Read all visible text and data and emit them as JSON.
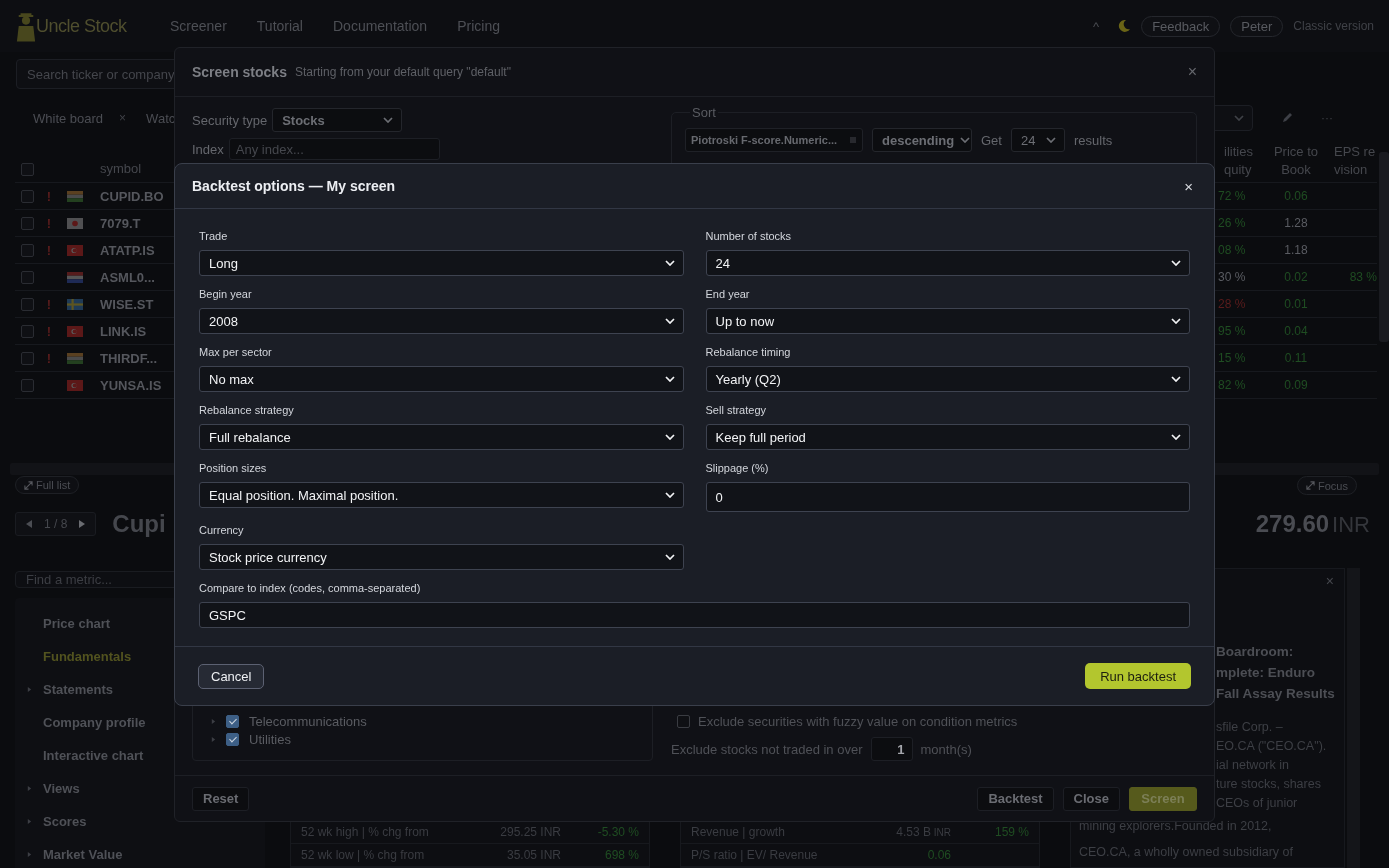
{
  "header": {
    "logo": "Uncle Stock",
    "nav": [
      "Screener",
      "Tutorial",
      "Documentation",
      "Pricing"
    ],
    "caret": "^",
    "feedback": "Feedback",
    "user": "Peter",
    "classic": "Classic version"
  },
  "search": {
    "placeholder": "Search ticker or company"
  },
  "tabs": [
    {
      "label": "White board",
      "close": "×"
    },
    {
      "label": "Watc"
    }
  ],
  "toolbar_more": "···",
  "symbol_table": {
    "column": "symbol",
    "select_all_checked": false,
    "rows": [
      {
        "symbol": "CUPID.BO",
        "alert": "!",
        "kind": "india",
        "checked": false
      },
      {
        "symbol": "7079.T",
        "alert": "!",
        "kind": "japan",
        "checked": false
      },
      {
        "symbol": "ATATP.IS",
        "alert": "!",
        "kind": "turkey",
        "checked": false
      },
      {
        "symbol": "ASML0...",
        "kind": "netherlands",
        "checked": false
      },
      {
        "symbol": "WISE.ST",
        "alert": "!",
        "kind": "sweden",
        "checked": false
      },
      {
        "symbol": "LINK.IS",
        "alert": "!",
        "kind": "turkey",
        "checked": false
      },
      {
        "symbol": "THIRDF...",
        "alert": "!",
        "kind": "india",
        "checked": false
      },
      {
        "symbol": "YUNSA.IS",
        "kind": "turkey",
        "checked": false
      }
    ]
  },
  "metric_table": {
    "columns": [
      "ilities quity",
      "Price to Book",
      "EPS revision"
    ],
    "rows": [
      [
        {
          "text": "72 %",
          "color": "#1f4d22"
        },
        {
          "text": "0.06",
          "color": "#1f4d22"
        }
      ],
      [
        {
          "text": "26 %",
          "color": "#1f4d22"
        },
        {
          "text": "1.28",
          "color": "#5a5c62"
        }
      ],
      [
        {
          "text": "08 %",
          "color": "#1f4d22"
        },
        {
          "text": "1.18",
          "color": "#5a5c62"
        }
      ],
      [
        {
          "text": "30 %",
          "color": "#5a5c62"
        },
        {
          "text": "0.02",
          "color": "#1f4d22"
        },
        {
          "text": "83 %",
          "color": "#1f4d22"
        }
      ],
      [
        {
          "text": "28 %",
          "color": "#5a1c1c"
        },
        {
          "text": "0.01",
          "color": "#1f4d22"
        }
      ],
      [
        {
          "text": "95 %",
          "color": "#1f4d22"
        },
        {
          "text": "0.04",
          "color": "#1f4d22"
        }
      ],
      [
        {
          "text": "15 %",
          "color": "#1f4d22"
        },
        {
          "text": "0.11",
          "color": "#1f4d22"
        }
      ],
      [
        {
          "text": "82 %",
          "color": "#1f4d22"
        },
        {
          "text": "0.09",
          "color": "#1f4d22"
        }
      ]
    ]
  },
  "lower": {
    "full_list": "Full list",
    "page": "1 / 8",
    "company_title": "Cupi",
    "focus": "Focus",
    "price": "279.60",
    "currency": "INR",
    "metric_search": {
      "placeholder": "Find a metric..."
    },
    "menu": [
      {
        "label": "Price chart",
        "caret": false,
        "selected": false
      },
      {
        "label": "Fundamentals",
        "caret": false,
        "selected": true
      },
      {
        "label": "Statements",
        "caret": true,
        "selected": false
      },
      {
        "label": "Company profile",
        "caret": false,
        "selected": false
      },
      {
        "label": "Interactive chart",
        "caret": false,
        "selected": false
      },
      {
        "label": "Views",
        "caret": true,
        "selected": false
      },
      {
        "label": "Scores",
        "caret": true,
        "selected": false
      },
      {
        "label": "Market Value",
        "caret": true,
        "selected": false
      }
    ],
    "stats_left": [
      {
        "label": "52 wk high | % chg from",
        "value": {
          "text": "295.25 INR"
        },
        "change": {
          "text": "-5.30 %",
          "color": "#1f4d22"
        }
      },
      {
        "label": "52 wk low | % chg from",
        "value": {
          "text": "35.05 INR"
        },
        "change": {
          "text": "698 %",
          "color": "#1f4d22"
        }
      }
    ],
    "stats_right": [
      {
        "label": "Revenue | growth",
        "value": {
          "text": "4.53 B",
          "unit": "INR"
        },
        "change": {
          "text": "159 %",
          "color": "#1f4d22"
        }
      },
      {
        "label": "P/S ratio | EV/ Revenue",
        "value": {
          "text": "0.06",
          "color": "#1f4d22"
        }
      }
    ],
    "news": {
      "close": "×",
      "headline": [
        "Boardroom:",
        "mplete: Enduro",
        "Fall Assay Results"
      ],
      "body_cut": [
        "sfile Corp. –",
        "EO.CA (\"CEO.CA\").",
        "ial network in",
        "ture stocks, shares",
        "CEOs of junior"
      ],
      "body": [
        "mining explorers.Founded in 2012,",
        "CEO.CA, a wholly owned subsidiary of"
      ]
    }
  },
  "screen_stocks": {
    "title": "Screen stocks",
    "subtitle": "Starting from your default query \"default\"",
    "close": "×",
    "security_type": {
      "label": "Security type",
      "value": "Stocks"
    },
    "index": {
      "label": "Index",
      "placeholder": "Any index..."
    },
    "sort": {
      "legend": "Sort",
      "metric": "Piotroski F-score.Numeric...",
      "order": "descending",
      "get_label": "Get",
      "count": "24",
      "results_label": "results"
    },
    "sectors": [
      {
        "label": "Telecommunications",
        "checked": true
      },
      {
        "label": "Utilities",
        "checked": true
      }
    ],
    "options": [
      {
        "label": "Exclude securities with fuzzy value on condition metrics",
        "checked": false
      }
    ],
    "traded": {
      "before": "Exclude stocks not traded in over",
      "value": "1",
      "after": "month(s)"
    },
    "reset": "Reset",
    "buttons": [
      {
        "label": "Backtest",
        "kind": "secondary"
      },
      {
        "label": "Close",
        "kind": "secondary"
      },
      {
        "label": "Screen",
        "kind": "primary"
      }
    ]
  },
  "backtest": {
    "title": "Backtest options — My screen",
    "close": "×",
    "fields": [
      {
        "label": "Trade",
        "value": "Long",
        "kind": "select"
      },
      {
        "label": "Number of stocks",
        "value": "24",
        "kind": "select"
      },
      {
        "label": "Begin year",
        "value": "2008",
        "kind": "select"
      },
      {
        "label": "End year",
        "value": "Up to now",
        "kind": "select"
      },
      {
        "label": "Max per sector",
        "value": "No max",
        "kind": "select"
      },
      {
        "label": "Rebalance timing",
        "value": "Yearly (Q2)",
        "kind": "select"
      },
      {
        "label": "Rebalance strategy",
        "value": "Full rebalance",
        "kind": "select"
      },
      {
        "label": "Sell strategy",
        "value": "Keep full period",
        "kind": "select"
      },
      {
        "label": "Position sizes",
        "value": "Equal position. Maximal position.",
        "kind": "select"
      },
      {
        "label": "Slippage (%)",
        "value": "0",
        "kind": "input"
      },
      {
        "label": "Currency",
        "value": "Stock price currency",
        "kind": "select"
      },
      {
        "label": "Compare to index (codes, comma-separated)",
        "value": "GSPC",
        "kind": "input",
        "wide": true
      }
    ],
    "cancel": "Cancel",
    "run": "Run backtest"
  }
}
